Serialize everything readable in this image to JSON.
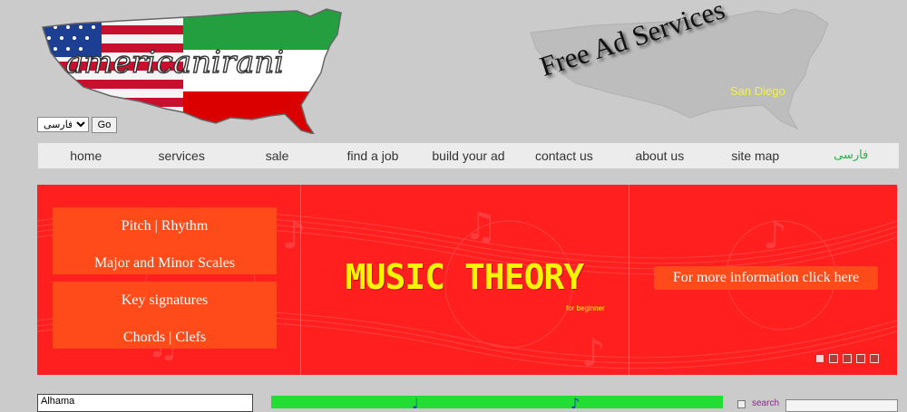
{
  "header": {
    "logo_text": "americanirani",
    "language_select": {
      "selected": "فارسی"
    },
    "go_button": "Go",
    "promo_title": "Free Ad Services",
    "promo_city": "San Diego"
  },
  "nav": {
    "items": [
      {
        "label": "home"
      },
      {
        "label": "services"
      },
      {
        "label": "sale"
      },
      {
        "label": "find a job"
      },
      {
        "label": "build your ad"
      },
      {
        "label": "contact us"
      },
      {
        "label": "about us"
      },
      {
        "label": "site map"
      },
      {
        "label": "فارسی"
      }
    ]
  },
  "banner": {
    "menu": [
      {
        "label": "Pitch | Rhythm"
      },
      {
        "label": "Major and Minor Scales"
      },
      {
        "label": "Key signatures"
      },
      {
        "label": "Chords | Clefs"
      }
    ],
    "title": "MUSIC THEORY",
    "subtitle": "for beginner",
    "info_button": "For more information click here",
    "slide_count": 5,
    "active_slide": 1
  },
  "bottom": {
    "city_value": "Alhama",
    "search_label": "search"
  },
  "colors": {
    "page_bg": "#cbcbcb",
    "banner_red": "#ff1f1f",
    "banner_orange": "#ff4a1a",
    "title_yellow": "#f7f700",
    "farsi_green": "#24b34a"
  }
}
